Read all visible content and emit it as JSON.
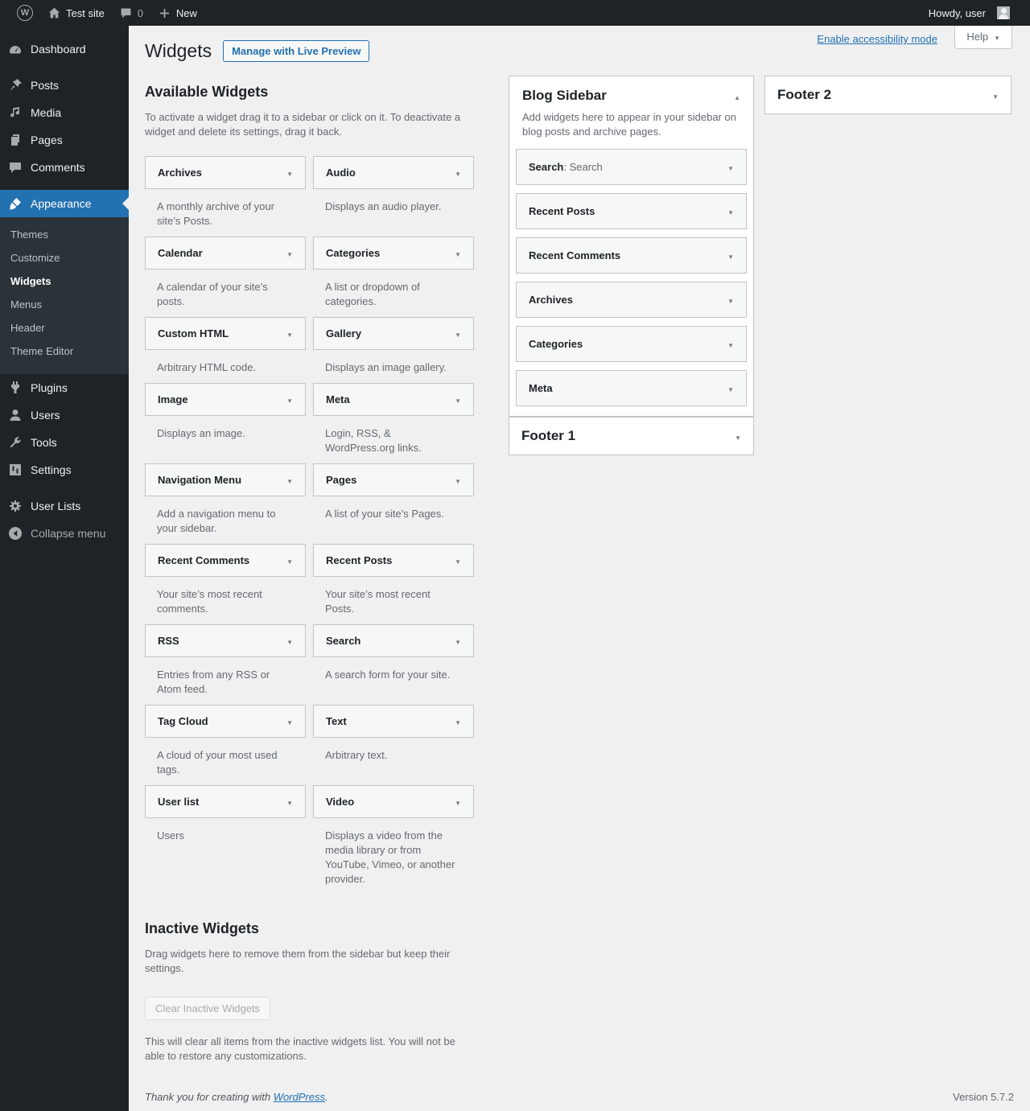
{
  "admin_bar": {
    "site_name": "Test site",
    "comments_count": "0",
    "new_label": "New",
    "howdy": "Howdy, user"
  },
  "sidebar": {
    "items": [
      {
        "label": "Dashboard"
      },
      {
        "label": "Posts"
      },
      {
        "label": "Media"
      },
      {
        "label": "Pages"
      },
      {
        "label": "Comments"
      },
      {
        "label": "Appearance",
        "submenu": [
          "Themes",
          "Customize",
          "Widgets",
          "Menus",
          "Header",
          "Theme Editor"
        ],
        "current_submenu": "Widgets"
      },
      {
        "label": "Plugins"
      },
      {
        "label": "Users"
      },
      {
        "label": "Tools"
      },
      {
        "label": "Settings"
      },
      {
        "label": "User Lists"
      }
    ],
    "collapse_label": "Collapse menu"
  },
  "page": {
    "title": "Widgets",
    "manage_button": "Manage with Live Preview",
    "accessibility_link": "Enable accessibility mode",
    "help_label": "Help"
  },
  "available": {
    "title": "Available Widgets",
    "intro": "To activate a widget drag it to a sidebar or click on it. To deactivate a widget and delete its settings, drag it back.",
    "widgets": [
      {
        "name": "Archives",
        "desc": "A monthly archive of your site’s Posts."
      },
      {
        "name": "Audio",
        "desc": "Displays an audio player."
      },
      {
        "name": "Calendar",
        "desc": "A calendar of your site’s posts."
      },
      {
        "name": "Categories",
        "desc": "A list or dropdown of categories."
      },
      {
        "name": "Custom HTML",
        "desc": "Arbitrary HTML code."
      },
      {
        "name": "Gallery",
        "desc": "Displays an image gallery."
      },
      {
        "name": "Image",
        "desc": "Displays an image."
      },
      {
        "name": "Meta",
        "desc": "Login, RSS, & WordPress.org links."
      },
      {
        "name": "Navigation Menu",
        "desc": "Add a navigation menu to your sidebar."
      },
      {
        "name": "Pages",
        "desc": "A list of your site’s Pages."
      },
      {
        "name": "Recent Comments",
        "desc": "Your site’s most recent comments."
      },
      {
        "name": "Recent Posts",
        "desc": "Your site’s most recent Posts."
      },
      {
        "name": "RSS",
        "desc": "Entries from any RSS or Atom feed."
      },
      {
        "name": "Search",
        "desc": "A search form for your site."
      },
      {
        "name": "Tag Cloud",
        "desc": "A cloud of your most used tags."
      },
      {
        "name": "Text",
        "desc": "Arbitrary text."
      },
      {
        "name": "User list",
        "desc": "Users"
      },
      {
        "name": "Video",
        "desc": "Displays a video from the media library or from YouTube, Vimeo, or another provider."
      }
    ]
  },
  "inactive": {
    "title": "Inactive Widgets",
    "intro": "Drag widgets here to remove them from the sidebar but keep their settings.",
    "button": "Clear Inactive Widgets",
    "note": "This will clear all items from the inactive widgets list. You will not be able to restore any customizations."
  },
  "sidebars": {
    "blog": {
      "title": "Blog Sidebar",
      "desc": "Add widgets here to appear in your sidebar on blog posts and archive pages.",
      "widgets": [
        {
          "title": "Search",
          "suffix": ": Search"
        },
        {
          "title": "Recent Posts"
        },
        {
          "title": "Recent Comments"
        },
        {
          "title": "Archives"
        },
        {
          "title": "Categories"
        },
        {
          "title": "Meta"
        }
      ]
    },
    "footer1": {
      "title": "Footer 1"
    },
    "footer2": {
      "title": "Footer 2"
    }
  },
  "footer": {
    "thanks_prefix": "Thank you for creating with ",
    "wordpress_link": "WordPress",
    "thanks_suffix": ".",
    "version": "Version 5.7.2"
  },
  "colors": {
    "accent": "#2271b1",
    "adminbar_bg": "#1d2327",
    "submenu_bg": "#2c3338",
    "page_bg": "#f0f0f1",
    "card_bg": "#f6f7f7",
    "border": "#c3c4c7",
    "text_gray": "#646970",
    "heading": "#1d2327"
  }
}
